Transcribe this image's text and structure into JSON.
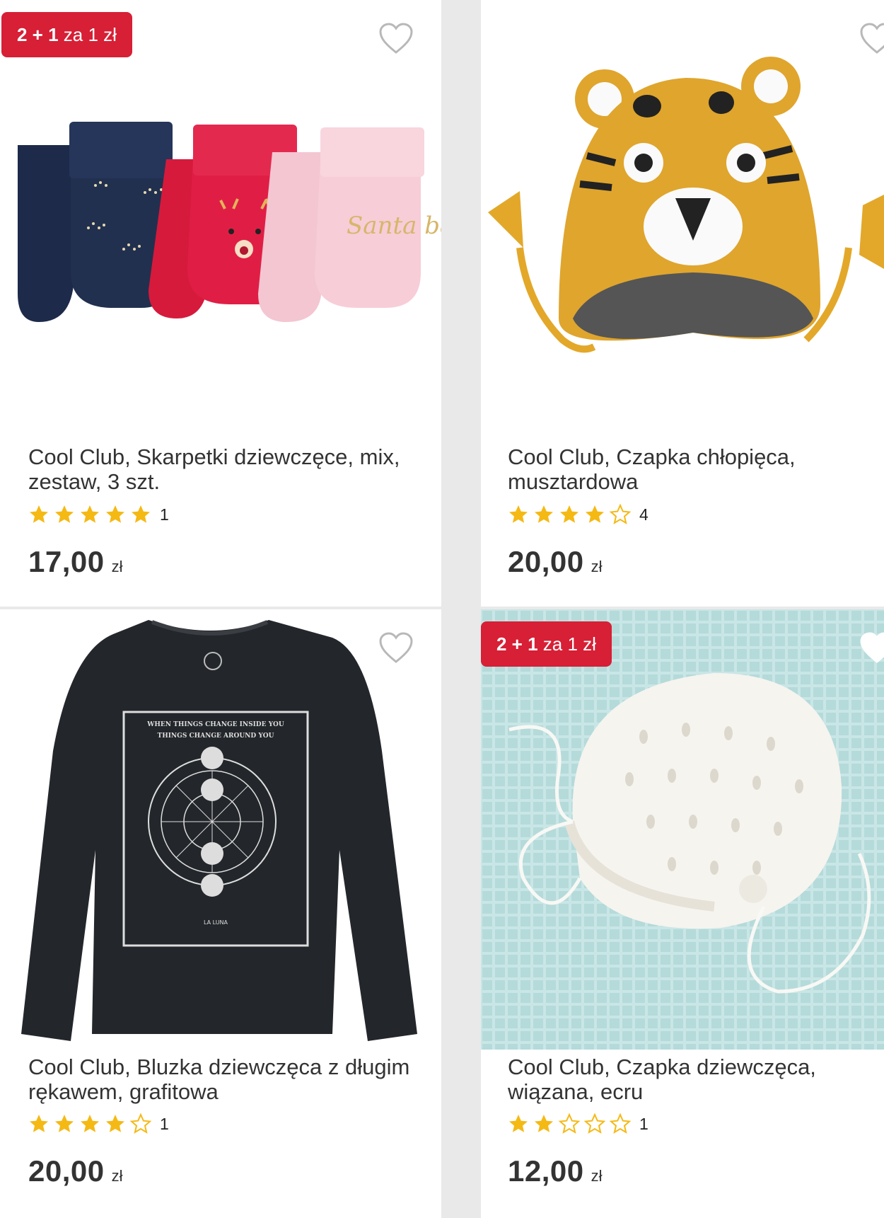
{
  "products": [
    {
      "badge": {
        "strong": "2 + 1",
        "rest": " za 1 zł"
      },
      "title": "Cool Club, Skarpetki dziewczęce, mix, zestaw, 3 szt.",
      "rating": 5,
      "rating_count": "1",
      "price": "17,00",
      "currency": "zł",
      "image_icon": "socks-image"
    },
    {
      "badge": null,
      "title": "Cool Club, Czapka chłopięca, musztardowa",
      "rating": 4,
      "rating_count": "4",
      "price": "20,00",
      "currency": "zł",
      "image_icon": "tiger-hat-image"
    },
    {
      "badge": null,
      "title": "Cool Club, Bluzka dziewczęca z długim rękawem, grafitowa",
      "rating": 4,
      "rating_count": "1",
      "price": "20,00",
      "currency": "zł",
      "image_icon": "shirt-image",
      "shirt_print": [
        "WHEN THINGS CHANGE INSIDE YOU",
        "THINGS CHANGE AROUND YOU",
        "LA LUNA"
      ]
    },
    {
      "badge": {
        "strong": "2 + 1",
        "rest": " za 1 zł"
      },
      "title": "Cool Club, Czapka dziewczęca, wiązana, ecru",
      "rating": 2,
      "rating_count": "1",
      "price": "12,00",
      "currency": "zł",
      "image_icon": "baby-bonnet-image"
    }
  ],
  "colors": {
    "badge": "#d71f35",
    "star": "#f5b914",
    "text": "#333333"
  },
  "sock_text": "Santa baby"
}
